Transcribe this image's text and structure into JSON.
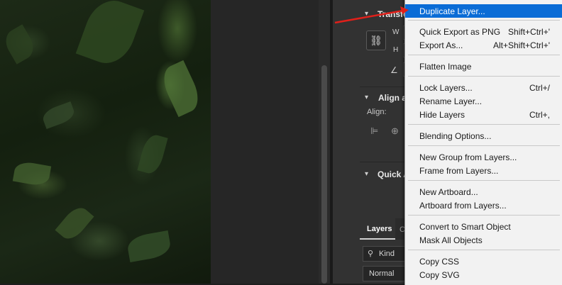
{
  "panel": {
    "transform_header": "Transfor",
    "width_label": "W",
    "height_label": "H",
    "angle_symbol": "∠",
    "link_symbol": "⛓",
    "align_header": "Align ar",
    "align_label": "Align:",
    "quick_header": "Quick A",
    "layers_tab": "Layers",
    "other_tab": "C",
    "kind_label": "Kind",
    "blend_mode": "Normal"
  },
  "menu": {
    "partial_top": "...",
    "items": [
      {
        "label": "Duplicate Layer...",
        "shortcut": ""
      },
      {
        "label": "Quick Export as PNG",
        "shortcut": "Shift+Ctrl+'"
      },
      {
        "label": "Export As...",
        "shortcut": "Alt+Shift+Ctrl+'"
      },
      {
        "label": "Flatten Image",
        "shortcut": ""
      },
      {
        "label": "Lock Layers...",
        "shortcut": "Ctrl+/"
      },
      {
        "label": "Rename Layer...",
        "shortcut": ""
      },
      {
        "label": "Hide Layers",
        "shortcut": "Ctrl+,"
      },
      {
        "label": "Blending Options...",
        "shortcut": ""
      },
      {
        "label": "New Group from Layers...",
        "shortcut": ""
      },
      {
        "label": "Frame from Layers...",
        "shortcut": ""
      },
      {
        "label": "New Artboard...",
        "shortcut": ""
      },
      {
        "label": "Artboard from Layers...",
        "shortcut": ""
      },
      {
        "label": "Convert to Smart Object",
        "shortcut": ""
      },
      {
        "label": "Mask All Objects",
        "shortcut": ""
      },
      {
        "label": "Copy CSS",
        "shortcut": ""
      },
      {
        "label": "Copy SVG",
        "shortcut": ""
      }
    ]
  },
  "colors": {
    "highlight": "#0a6cd6",
    "arrow": "#e0201a"
  }
}
